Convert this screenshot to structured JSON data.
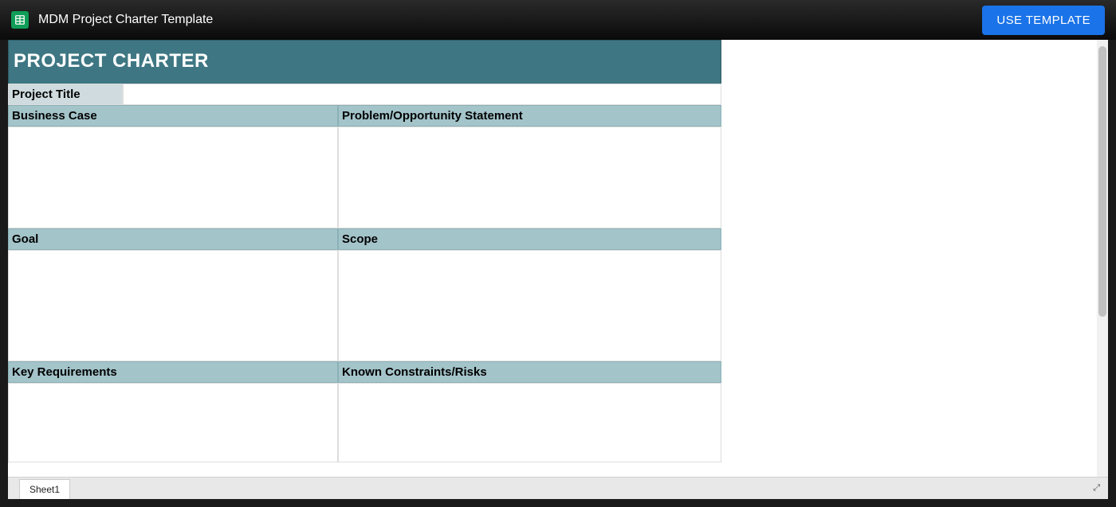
{
  "header": {
    "doc_title": "MDM Project Charter Template",
    "use_template_label": "USE TEMPLATE"
  },
  "sheet": {
    "banner": "PROJECT CHARTER",
    "project_title_label": "Project Title",
    "project_title_value": "",
    "sections": {
      "business_case": {
        "label": "Business Case",
        "value": ""
      },
      "problem_statement": {
        "label": "Problem/Opportunity Statement",
        "value": ""
      },
      "goal": {
        "label": "Goal",
        "value": ""
      },
      "scope": {
        "label": "Scope",
        "value": ""
      },
      "key_requirements": {
        "label": "Key Requirements",
        "value": ""
      },
      "constraints_risks": {
        "label": "Known Constraints/Risks",
        "value": ""
      }
    }
  },
  "tabs": {
    "sheet1": "Sheet1"
  },
  "colors": {
    "banner_bg": "#3e7783",
    "section_header_bg": "#a3c4c9",
    "title_label_bg": "#cfdbde",
    "button_bg": "#1a73e8"
  }
}
